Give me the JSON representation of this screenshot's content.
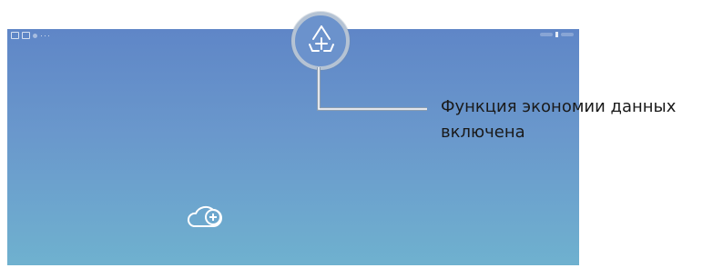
{
  "status_bar": {
    "left_icons": [
      "notification-icon",
      "image-icon",
      "dot-icon",
      "more-icon"
    ],
    "right_icons": [
      "battery-icon"
    ]
  },
  "screen": {
    "center_icon": "cloud-add-icon"
  },
  "magnifier": {
    "icon": "data-saver-icon"
  },
  "callout": {
    "line1": "Функция экономии данных",
    "line2": "включена"
  },
  "colors": {
    "screen_top": "#5f86c7",
    "screen_bottom": "#6fb1cf",
    "magnifier_border": "#b5c3d4",
    "callout_line": "#8a9cb0"
  }
}
